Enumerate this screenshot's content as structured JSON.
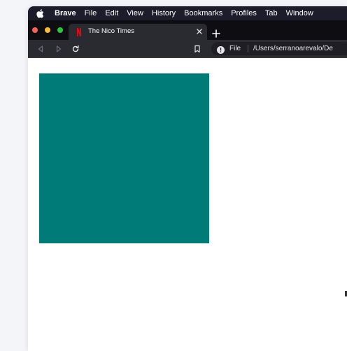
{
  "menubar": {
    "app_name": "Brave",
    "items": [
      "File",
      "Edit",
      "View",
      "History",
      "Bookmarks",
      "Profiles",
      "Tab",
      "Window"
    ]
  },
  "tab": {
    "title": "The Nico Times",
    "favicon": "netflix-n-icon"
  },
  "toolbar": {
    "scheme_label": "File",
    "url_path": "/Users/serranoarevalo/De"
  },
  "colors": {
    "teal_box": "#007b78",
    "favicon": "#e50914"
  }
}
